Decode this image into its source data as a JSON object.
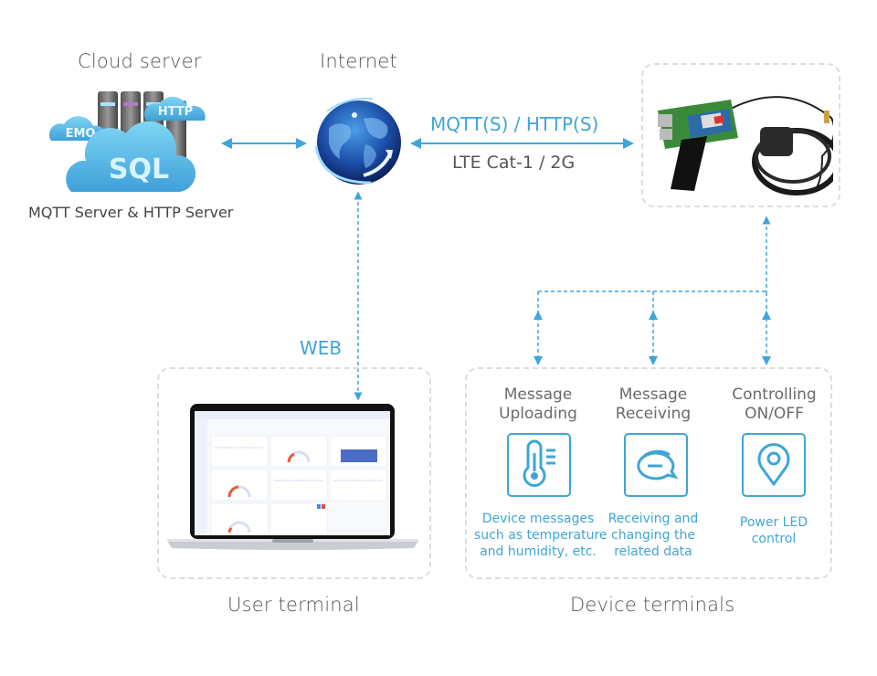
{
  "colors": {
    "accent": "#3fa5d8",
    "text": "#555555",
    "dashed_border": "#dcdcdc"
  },
  "cloud_server": {
    "title": "Cloud server",
    "cloud_labels": [
      "HTTP",
      "EMQ",
      "SQL"
    ],
    "caption": "MQTT Server & HTTP Server"
  },
  "internet": {
    "title": "Internet"
  },
  "link": {
    "protocol": "MQTT(S) / HTTP(S)",
    "network": "LTE Cat-1 / 2G"
  },
  "web_label": "WEB",
  "user_terminal": {
    "title": "User terminal"
  },
  "device_terminals": {
    "title": "Device terminals",
    "features": [
      {
        "title_line1": "Message",
        "title_line2": "Uploading",
        "icon": "thermometer-icon",
        "desc": [
          "Device messages",
          "such as temperature",
          "and humidity, etc."
        ]
      },
      {
        "title_line1": "Message",
        "title_line2": "Receiving",
        "icon": "chat-bubble-icon",
        "desc": [
          "Receiving and",
          "changing the",
          "related data"
        ]
      },
      {
        "title_line1": "Controlling",
        "title_line2": "ON/OFF",
        "icon": "location-pin-icon",
        "desc": [
          "Power LED",
          "control"
        ]
      }
    ]
  }
}
